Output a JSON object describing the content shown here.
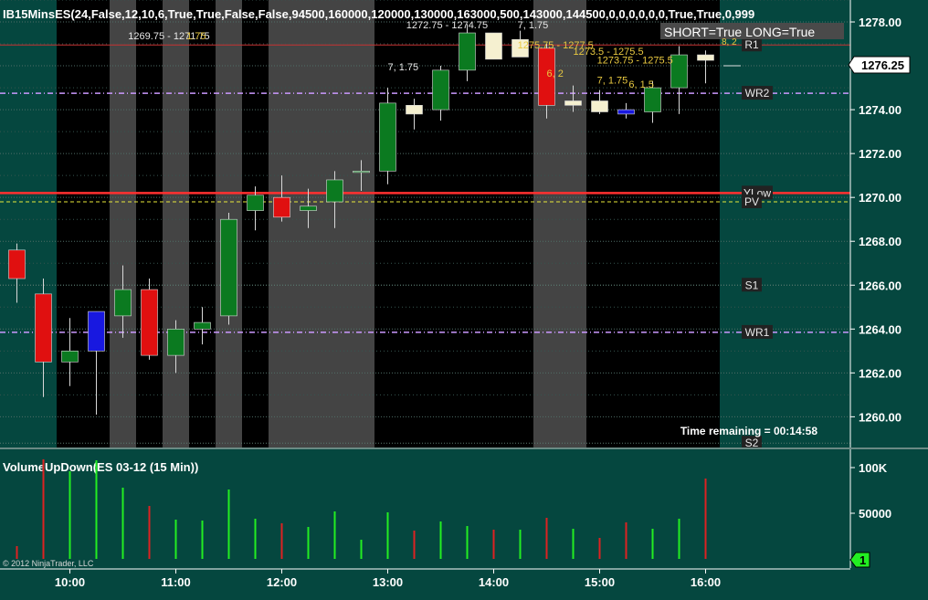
{
  "header": {
    "indicator_string": "IB15MinsES(24,False,12,10,6,True,True,False,False,94500,160000,120000,130000,163000,500,143000,144500,0,0,0,0,0,0,True,True,0,999",
    "mode_label": "SHORT=True LONG=True",
    "mode_sub": "8, 2"
  },
  "price_panel": {
    "ymin": 1258.6,
    "ymax": 1279.0,
    "ticks": [
      "1260.00",
      "1262.00",
      "1264.00",
      "1266.00",
      "1268.00",
      "1270.00",
      "1272.00",
      "1274.00",
      "1276.00",
      "1278.00"
    ],
    "current_price": "1276.25",
    "time_remaining": "Time remaining = 00:14:58",
    "levels": [
      {
        "label": "R1",
        "price": 1276.95,
        "color": "#c83232",
        "style": "solid"
      },
      {
        "label": "WR2",
        "price": 1274.75,
        "color": "#cc99ff",
        "style": "dashdot"
      },
      {
        "label": "YLow",
        "price": 1270.2,
        "color": "#ff3030",
        "style": "thick"
      },
      {
        "label": "PV",
        "price": 1269.8,
        "color": "#e8e83a",
        "style": "dashed"
      },
      {
        "label": "S1",
        "price": 1266.0,
        "color": "#5a7a70",
        "style": "dotted"
      },
      {
        "label": "WR1",
        "price": 1263.85,
        "color": "#cc99ff",
        "style": "dashdot"
      },
      {
        "label": "S2",
        "price": 1258.8,
        "color": "#5a7a70",
        "style": "dotted"
      }
    ],
    "annotations": [
      {
        "text": "1269.75 - 1271.75",
        "color": "#e8e8e8",
        "t": 4.2,
        "price": 1277.2
      },
      {
        "text": "1.75",
        "color": "#e8c840",
        "t": 6.4,
        "price": 1277.2
      },
      {
        "text": "1272.75 - 1274.75",
        "color": "#e8e8e8",
        "t": 14.7,
        "price": 1277.7
      },
      {
        "text": "7, 1.75",
        "color": "#e8e8e8",
        "t": 18.9,
        "price": 1277.7
      },
      {
        "text": "7, 1.75",
        "color": "#e8e8e8",
        "t": 14.0,
        "price": 1275.8
      },
      {
        "text": "1275.75 - 1277.5",
        "color": "#e8c840",
        "t": 18.9,
        "price": 1276.8
      },
      {
        "text": "1273.5 - 1275.5",
        "color": "#e8c840",
        "t": 21.0,
        "price": 1276.5
      },
      {
        "text": "1273.75 - 1275.5",
        "color": "#e8c840",
        "t": 21.9,
        "price": 1276.1
      },
      {
        "text": "6, 2",
        "color": "#e8c840",
        "t": 20.0,
        "price": 1275.5
      },
      {
        "text": "7, 1.75",
        "color": "#e8c840",
        "t": 21.9,
        "price": 1275.2
      },
      {
        "text": "6, 1.5",
        "color": "#e8c840",
        "t": 23.1,
        "price": 1275.0
      }
    ]
  },
  "volume_panel": {
    "title": "VolumeUpDown(ES 03-12 (15 Min))",
    "ymax": 120000,
    "ticks": [
      {
        "label": "100K",
        "value": 100000
      },
      {
        "label": "50000",
        "value": 50000
      }
    ],
    "current_label": "1"
  },
  "time_axis": {
    "labels": [
      {
        "text": "10:00",
        "t": 2
      },
      {
        "text": "11:00",
        "t": 6
      },
      {
        "text": "12:00",
        "t": 10
      },
      {
        "text": "13:00",
        "t": 14
      },
      {
        "text": "14:00",
        "t": 18
      },
      {
        "text": "15:00",
        "t": 22
      },
      {
        "text": "16:00",
        "t": 26
      }
    ]
  },
  "copyright": "© 2012 NinjaTrader, LLC",
  "colors": {
    "background": "#05473f",
    "session": "#000000",
    "band": "#444444",
    "up": "#0b7a20",
    "down": "#e01010",
    "neutral_blue": "#1818e0",
    "doji": "#f5f0d0",
    "vol_up": "#22ee22",
    "vol_down": "#dd2222"
  },
  "chart_data": {
    "type": "candlestick",
    "x_start": "09:45",
    "x_interval": "15 min",
    "bands": [
      [
        4,
        5
      ],
      [
        6,
        7
      ],
      [
        8,
        9
      ],
      [
        10,
        14
      ],
      [
        20,
        22
      ]
    ],
    "candles": [
      {
        "open": 1267.6,
        "high": 1267.9,
        "low": 1265.2,
        "close": 1266.3,
        "color": "down"
      },
      {
        "open": 1265.6,
        "high": 1266.3,
        "low": 1260.9,
        "close": 1262.5,
        "color": "down"
      },
      {
        "open": 1262.5,
        "high": 1264.5,
        "low": 1261.4,
        "close": 1263.0,
        "color": "up"
      },
      {
        "open": 1264.8,
        "high": 1264.8,
        "low": 1260.1,
        "close": 1263.0,
        "color": "blue"
      },
      {
        "open": 1264.6,
        "high": 1266.9,
        "low": 1263.6,
        "close": 1265.8,
        "color": "up"
      },
      {
        "open": 1265.8,
        "high": 1266.3,
        "low": 1262.6,
        "close": 1262.8,
        "color": "down"
      },
      {
        "open": 1262.8,
        "high": 1264.4,
        "low": 1262.0,
        "close": 1264.0,
        "color": "up"
      },
      {
        "open": 1264.0,
        "high": 1265.0,
        "low": 1263.3,
        "close": 1264.3,
        "color": "up"
      },
      {
        "open": 1264.6,
        "high": 1269.3,
        "low": 1264.2,
        "close": 1269.0,
        "color": "up"
      },
      {
        "open": 1269.4,
        "high": 1270.5,
        "low": 1268.5,
        "close": 1270.1,
        "color": "up"
      },
      {
        "open": 1270.0,
        "high": 1271.0,
        "low": 1268.9,
        "close": 1269.1,
        "color": "down"
      },
      {
        "open": 1269.4,
        "high": 1270.4,
        "low": 1268.6,
        "close": 1269.6,
        "color": "up"
      },
      {
        "open": 1269.8,
        "high": 1271.2,
        "low": 1268.6,
        "close": 1270.8,
        "color": "up"
      },
      {
        "open": 1271.2,
        "high": 1271.7,
        "low": 1270.3,
        "close": 1271.2,
        "color": "up"
      },
      {
        "open": 1271.2,
        "high": 1275.0,
        "low": 1270.6,
        "close": 1274.3,
        "color": "up"
      },
      {
        "open": 1273.8,
        "high": 1274.5,
        "low": 1273.1,
        "close": 1274.2,
        "color": "doji"
      },
      {
        "open": 1274.0,
        "high": 1276.0,
        "low": 1273.5,
        "close": 1275.8,
        "color": "up"
      },
      {
        "open": 1275.8,
        "high": 1277.9,
        "low": 1275.3,
        "close": 1277.5,
        "color": "up"
      },
      {
        "open": 1277.5,
        "high": 1277.5,
        "low": 1276.3,
        "close": 1276.3,
        "color": "doji"
      },
      {
        "open": 1277.2,
        "high": 1277.6,
        "low": 1276.5,
        "close": 1276.4,
        "color": "doji"
      },
      {
        "open": 1276.8,
        "high": 1277.0,
        "low": 1273.6,
        "close": 1274.2,
        "color": "down"
      },
      {
        "open": 1274.4,
        "high": 1275.1,
        "low": 1273.9,
        "close": 1274.2,
        "color": "doji"
      },
      {
        "open": 1274.4,
        "high": 1274.9,
        "low": 1273.8,
        "close": 1273.9,
        "color": "doji"
      },
      {
        "open": 1274.0,
        "high": 1274.3,
        "low": 1273.6,
        "close": 1273.8,
        "color": "blue"
      },
      {
        "open": 1273.9,
        "high": 1275.3,
        "low": 1273.4,
        "close": 1275.0,
        "color": "up"
      },
      {
        "open": 1275.0,
        "high": 1276.9,
        "low": 1273.8,
        "close": 1276.5,
        "color": "up"
      },
      {
        "open": 1276.5,
        "high": 1276.7,
        "low": 1275.2,
        "close": 1276.25,
        "color": "doji"
      }
    ],
    "volume": [
      {
        "value": 14000,
        "dir": "down"
      },
      {
        "value": 109000,
        "dir": "down"
      },
      {
        "value": 96000,
        "dir": "up"
      },
      {
        "value": 108000,
        "dir": "up"
      },
      {
        "value": 78000,
        "dir": "up"
      },
      {
        "value": 58000,
        "dir": "down"
      },
      {
        "value": 43000,
        "dir": "up"
      },
      {
        "value": 42000,
        "dir": "up"
      },
      {
        "value": 76000,
        "dir": "up"
      },
      {
        "value": 44000,
        "dir": "up"
      },
      {
        "value": 39000,
        "dir": "down"
      },
      {
        "value": 35000,
        "dir": "up"
      },
      {
        "value": 52000,
        "dir": "up"
      },
      {
        "value": 21000,
        "dir": "up"
      },
      {
        "value": 51000,
        "dir": "up"
      },
      {
        "value": 31000,
        "dir": "down"
      },
      {
        "value": 41000,
        "dir": "up"
      },
      {
        "value": 36000,
        "dir": "up"
      },
      {
        "value": 32000,
        "dir": "down"
      },
      {
        "value": 32000,
        "dir": "up"
      },
      {
        "value": 45000,
        "dir": "down"
      },
      {
        "value": 33000,
        "dir": "up"
      },
      {
        "value": 23000,
        "dir": "down"
      },
      {
        "value": 40000,
        "dir": "down"
      },
      {
        "value": 33000,
        "dir": "up"
      },
      {
        "value": 44000,
        "dir": "up"
      },
      {
        "value": 88000,
        "dir": "down"
      }
    ]
  }
}
